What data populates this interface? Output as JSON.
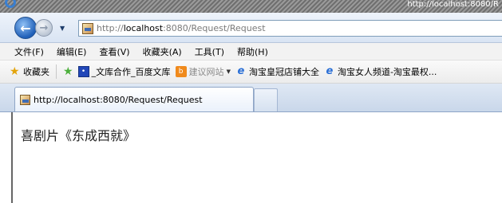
{
  "window": {
    "title": "http://localhost:8080/R"
  },
  "nav": {
    "back_icon": "back-arrow-icon",
    "forward_icon": "forward-arrow-icon",
    "dropdown_glyph": "▼"
  },
  "address": {
    "prefix": "http://",
    "host": "localhost",
    "rest": ":8080/Request/Request"
  },
  "menu": {
    "items": [
      {
        "label": "文件(F)"
      },
      {
        "label": "编辑(E)"
      },
      {
        "label": "查看(V)"
      },
      {
        "label": "收藏夹(A)"
      },
      {
        "label": "工具(T)"
      },
      {
        "label": "帮助(H)"
      }
    ]
  },
  "favorites": {
    "favorites_label": "收藏夹",
    "items": [
      {
        "label": "_文库合作_百度文库",
        "icon": "baidu-icon"
      },
      {
        "label": "建议网站",
        "icon": "suggested-sites-icon"
      },
      {
        "label": "淘宝皇冠店铺大全",
        "icon": "ie-page-icon"
      },
      {
        "label": "淘宝女人频道-淘宝最权...",
        "icon": "ie-page-icon"
      }
    ]
  },
  "tabs": {
    "active_label": "http://localhost:8080/Request/Request"
  },
  "page": {
    "text": "喜剧片《东成西就》"
  },
  "colors": {
    "nav_back": "#1f5fb8",
    "tab_border": "#8ea5c6"
  }
}
